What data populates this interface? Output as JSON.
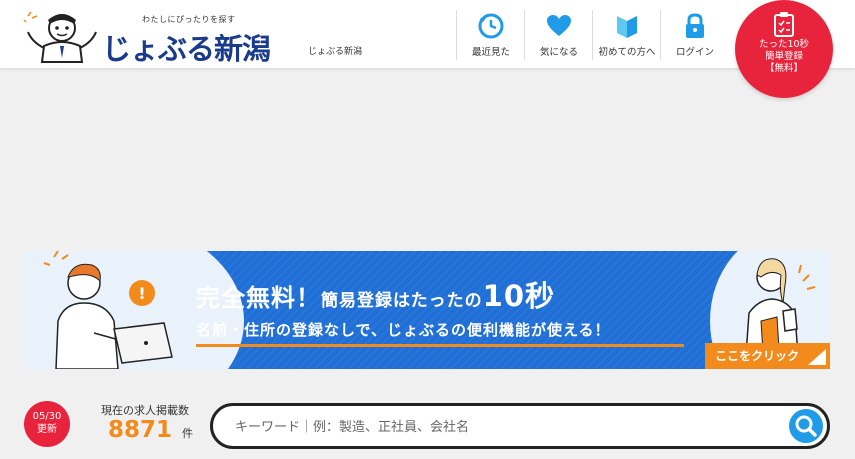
{
  "header": {
    "tagline": "わたしにぴったりを探す",
    "logo_text": "じょぶる新潟",
    "site_name": "じょぶる新潟",
    "nav": [
      {
        "label": "最近見た",
        "icon": "history-icon"
      },
      {
        "label": "気になる",
        "icon": "heart-icon"
      },
      {
        "label": "初めての方へ",
        "icon": "beginner-icon"
      },
      {
        "label": "ログイン",
        "icon": "lock-icon"
      }
    ],
    "register": {
      "line1": "たった10秒",
      "line2": "簡単登録",
      "line3": "【無料】",
      "icon": "clipboard-icon"
    }
  },
  "banner": {
    "headline_part1": "完全無料！",
    "headline_part2": "簡易登録はたったの",
    "headline_part3": "10秒",
    "subline": "名前・住所の登録なしで、じょぶるの便利機能が使える！",
    "cta": "ここをクリック"
  },
  "jobs": {
    "updated_date": "05/30",
    "updated_label": "更新",
    "count_label": "現在の求人掲載数",
    "count": "8871",
    "count_unit": "件"
  },
  "search": {
    "placeholder": "キーワード｜例：製造、正社員、会社名",
    "value": ""
  },
  "colors": {
    "brand_blue": "#1a3a8c",
    "banner_blue": "#1f6fd6",
    "accent_orange": "#f28b1c",
    "accent_red": "#e8243c",
    "icon_blue": "#1f9be8"
  }
}
